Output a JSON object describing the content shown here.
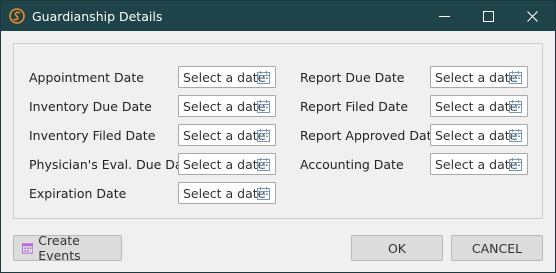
{
  "window": {
    "title": "Guardianship Details",
    "controls": {
      "minimize": "minimize",
      "maximize": "maximize",
      "close": "close"
    }
  },
  "fields": {
    "left": [
      {
        "label": "Appointment Date",
        "placeholder": "Select a date"
      },
      {
        "label": "Inventory Due Date",
        "placeholder": "Select a date"
      },
      {
        "label": "Inventory Filed Date",
        "placeholder": "Select a date"
      },
      {
        "label": "Physician's Eval. Due Date",
        "placeholder": "Select a date"
      },
      {
        "label": "Expiration Date",
        "placeholder": "Select a date"
      }
    ],
    "right": [
      {
        "label": "Report Due Date",
        "placeholder": "Select a date"
      },
      {
        "label": "Report Filed Date",
        "placeholder": "Select a date"
      },
      {
        "label": "Report Approved Date",
        "placeholder": "Select a date"
      },
      {
        "label": "Accounting Date",
        "placeholder": "Select a date"
      }
    ]
  },
  "footer": {
    "create_events": "Create Events",
    "ok": "OK",
    "cancel": "CANCEL"
  },
  "colors": {
    "titlebar": "#1e4348",
    "app_icon": "#f08a2c",
    "calendar_icon": "#7b97b8",
    "events_icon": "#b76ad9"
  },
  "icons": [
    "app-logo-icon",
    "minimize-icon",
    "maximize-icon",
    "close-icon",
    "calendar-icon",
    "events-calendar-icon"
  ]
}
